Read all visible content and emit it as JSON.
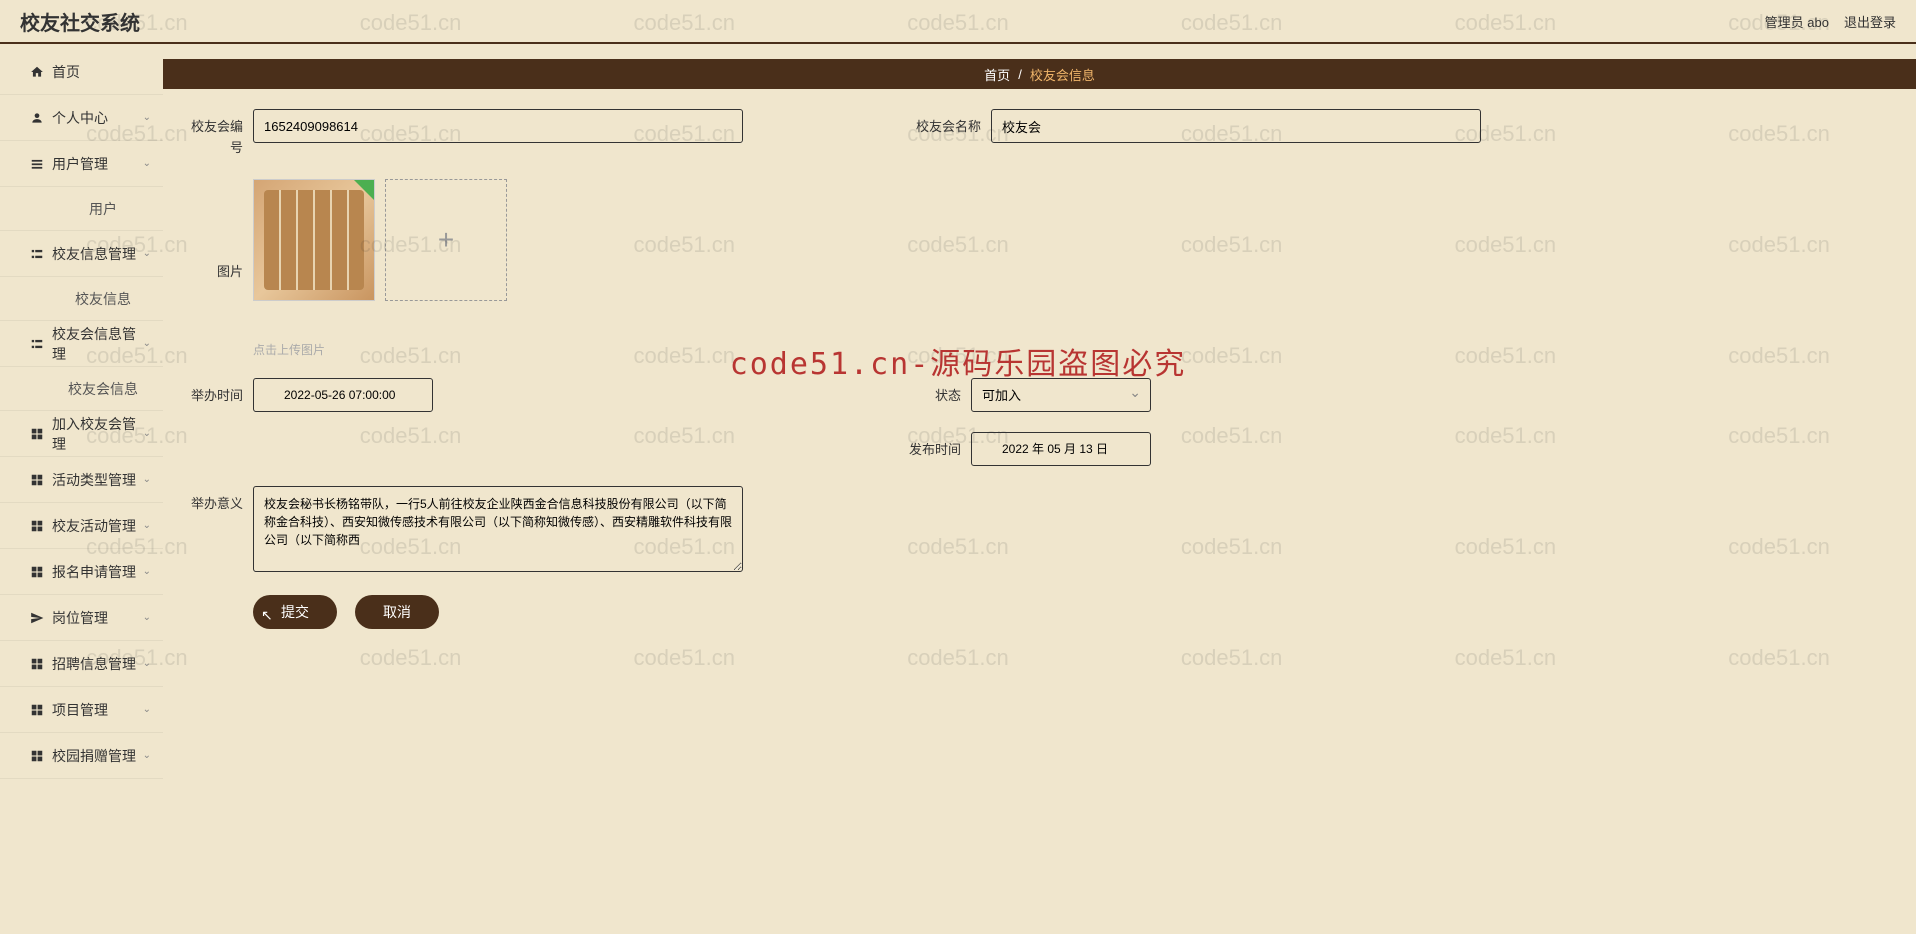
{
  "app": {
    "title": "校友社交系统"
  },
  "header": {
    "admin": "管理员 abo",
    "logout": "退出登录"
  },
  "sidebar": {
    "items": [
      {
        "label": "首页",
        "icon": "home",
        "hasChevron": false
      },
      {
        "label": "个人中心",
        "icon": "user",
        "hasChevron": true
      },
      {
        "label": "用户管理",
        "icon": "users",
        "hasChevron": true
      },
      {
        "label": "用户",
        "sub": true
      },
      {
        "label": "校友信息管理",
        "icon": "list",
        "hasChevron": true
      },
      {
        "label": "校友信息",
        "sub": true
      },
      {
        "label": "校友会信息管理",
        "icon": "list",
        "hasChevron": true
      },
      {
        "label": "校友会信息",
        "sub": true
      },
      {
        "label": "加入校友会管理",
        "icon": "grid",
        "hasChevron": true
      },
      {
        "label": "活动类型管理",
        "icon": "grid",
        "hasChevron": true
      },
      {
        "label": "校友活动管理",
        "icon": "grid",
        "hasChevron": true
      },
      {
        "label": "报名申请管理",
        "icon": "grid",
        "hasChevron": true
      },
      {
        "label": "岗位管理",
        "icon": "send",
        "hasChevron": true
      },
      {
        "label": "招聘信息管理",
        "icon": "grid",
        "hasChevron": true
      },
      {
        "label": "项目管理",
        "icon": "grid",
        "hasChevron": true
      },
      {
        "label": "校园捐赠管理",
        "icon": "grid",
        "hasChevron": true
      }
    ]
  },
  "breadcrumb": {
    "home": "首页",
    "sep": "/",
    "current": "校友会信息"
  },
  "form": {
    "id_label": "校友会编号",
    "id_value": "1652409098614",
    "name_label": "校友会名称",
    "name_value": "校友会",
    "image_label": "图片",
    "upload_hint": "点击上传图片",
    "time_label": "举办时间",
    "time_value": "2022-05-26 07:00:00",
    "status_label": "状态",
    "status_value": "可加入",
    "publish_label": "发布时间",
    "publish_value": "2022 年 05 月 13 日",
    "meaning_label": "举办意义",
    "meaning_value": "校友会秘书长杨铭带队，一行5人前往校友企业陕西金合信息科技股份有限公司（以下简称金合科技）、西安知微传感技术有限公司（以下简称知微传感）、西安精雕软件科技有限公司（以下简称西",
    "submit": "提交",
    "cancel": "取消"
  },
  "watermark": {
    "small": "code51.cn",
    "big": "code51.cn-源码乐园盗图必究"
  }
}
